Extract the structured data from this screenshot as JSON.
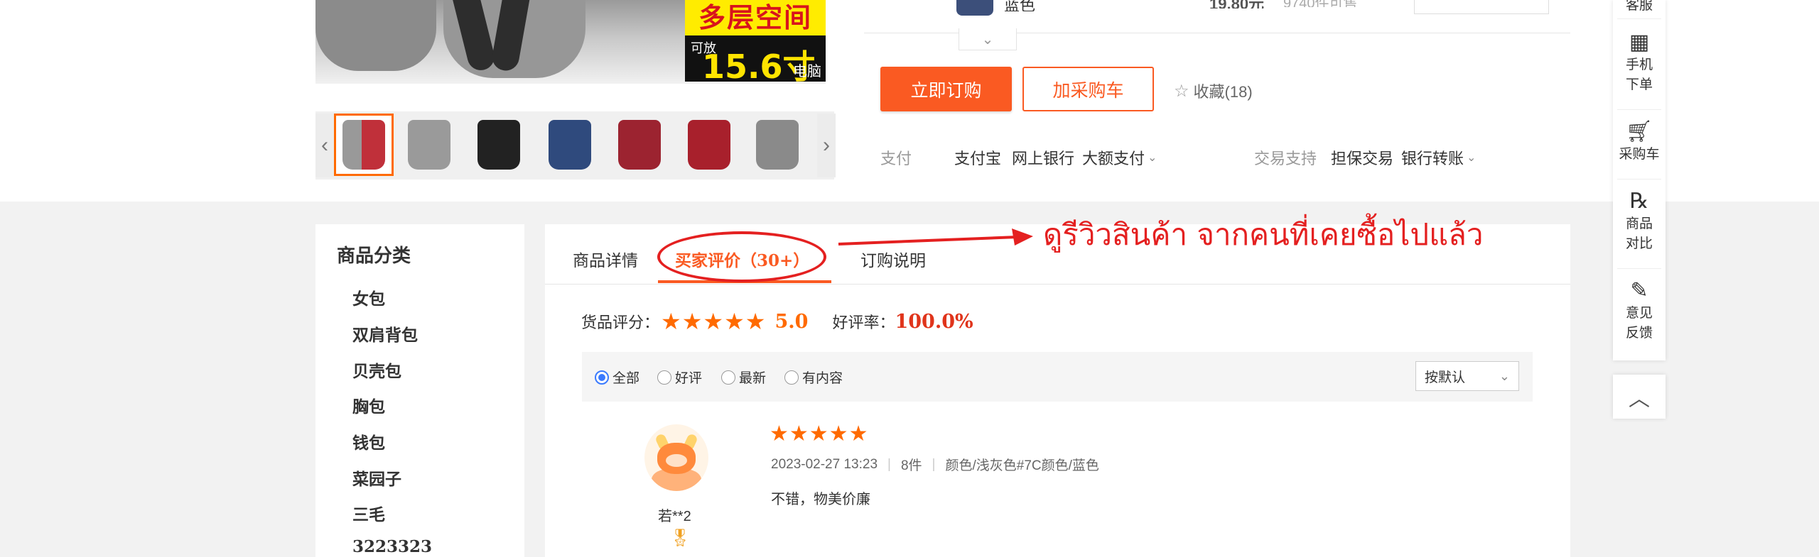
{
  "product": {
    "badge_top": "多层空间",
    "badge_small": "可放",
    "badge_size": "15.6寸",
    "badge_unit": "电脑"
  },
  "variant": {
    "name": "蓝色",
    "price": "19.80元",
    "stock": "9740件可售"
  },
  "actions": {
    "buy_label": "立即订购",
    "cart_label": "加采购车",
    "favorite_label": "收藏(18)"
  },
  "payment": {
    "label": "支付",
    "methods": [
      "支付宝",
      "网上银行",
      "大额支付"
    ],
    "trade_label": "交易支持",
    "trade_methods": [
      "担保交易",
      "银行转账"
    ]
  },
  "right_sidebar": {
    "items": [
      {
        "label": "客服",
        "icon": "headset-icon"
      },
      {
        "label": "手机\n下单",
        "icon": "qrcode-icon"
      },
      {
        "label": "采购车",
        "icon": "cart-icon"
      },
      {
        "label": "商品\n对比",
        "icon": "compare-icon"
      },
      {
        "label": "意见\n反馈",
        "icon": "edit-icon"
      }
    ],
    "back_to_top": "back-to-top-icon"
  },
  "categories": {
    "title": "商品分类",
    "items": [
      "女包",
      "双肩背包",
      "贝壳包",
      "胸包",
      "钱包",
      "菜园子",
      "三毛",
      "3223323"
    ]
  },
  "tabs": [
    {
      "label": "商品详情",
      "active": false
    },
    {
      "label": "买家评价（30+）",
      "active": true
    },
    {
      "label": "订购说明",
      "active": false
    }
  ],
  "annotation": {
    "text": "ดูรีวิวสินค้า จากคนที่เคยซื้อไปแล้ว",
    "color": "#e42020"
  },
  "rating": {
    "score_label": "货品评分：",
    "stars": 5,
    "score": "5.0",
    "good_rate_label": "好评率：",
    "good_rate": "100.0%"
  },
  "filters": {
    "options": [
      "全部",
      "好评",
      "最新",
      "有内容"
    ],
    "selected": "全部",
    "sort": "按默认"
  },
  "review": {
    "username": "若**2",
    "stars": 5,
    "date": "2023-02-27 13:23",
    "quantity": "8件",
    "spec": "颜色/浅灰色#7C颜色/蓝色",
    "content": "不错，物美价廉"
  },
  "colors": {
    "accent": "#fa5a22",
    "star": "#ff6a00",
    "radio_selected": "#3a7afe"
  }
}
